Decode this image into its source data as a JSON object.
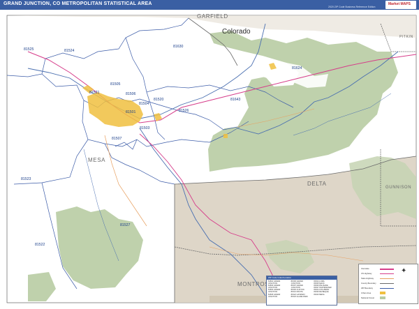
{
  "header": {
    "title": "GRAND JUNCTION, CO METROPOLITAN STATISTICAL AREA",
    "subtitle": "2020 ZIP Code Business Reference Edition",
    "brand": "Market MAPS"
  },
  "map": {
    "state_label": "Colorado",
    "counties": [
      "MESA",
      "DELTA",
      "GARFIELD",
      "MONTROSE",
      "GUNNISON",
      "PITKIN"
    ],
    "zip_codes": [
      "81525",
      "81524",
      "81630",
      "81505",
      "81506",
      "81504",
      "81501",
      "81507",
      "81520",
      "81503",
      "81526",
      "81643",
      "81624",
      "81521",
      "81523",
      "81527",
      "81522"
    ],
    "colors": {
      "forest": "#b8cca3",
      "desert": "#d8cfbe",
      "water": "#4a6fb0",
      "interstate": "#d63c8a",
      "highway": "#e8a060",
      "urban": "#f0c040",
      "zip_boundary": "#3c5ca8",
      "county_boundary": "#6a6a6a"
    }
  },
  "legend": {
    "heading": "ZIP Code Index/Location",
    "entries": [
      "81501 GRAND JUNCTION",
      "81503 GRAND JUNCTION",
      "81504 GRAND JUNCTION",
      "81505 GRAND JUNCTION",
      "81506 GRAND JUNCTION",
      "81507 GRAND JUNCTION",
      "81520 CLIFTON",
      "81521 FRUITA",
      "81522 GATEWAY",
      "81523 GLADE PARK",
      "81524 LOMA",
      "81525 MACK",
      "81526 PALISADE",
      "81527 WHITEWATER",
      "81624 COLLBRAN",
      "81630 DE BEQUE",
      "81643 MESA"
    ]
  },
  "key": {
    "items": [
      "Interstate",
      "US Highway",
      "State Highway",
      "County Boundary",
      "ZIP Boundary",
      "Urban Area",
      "National Forest"
    ]
  }
}
